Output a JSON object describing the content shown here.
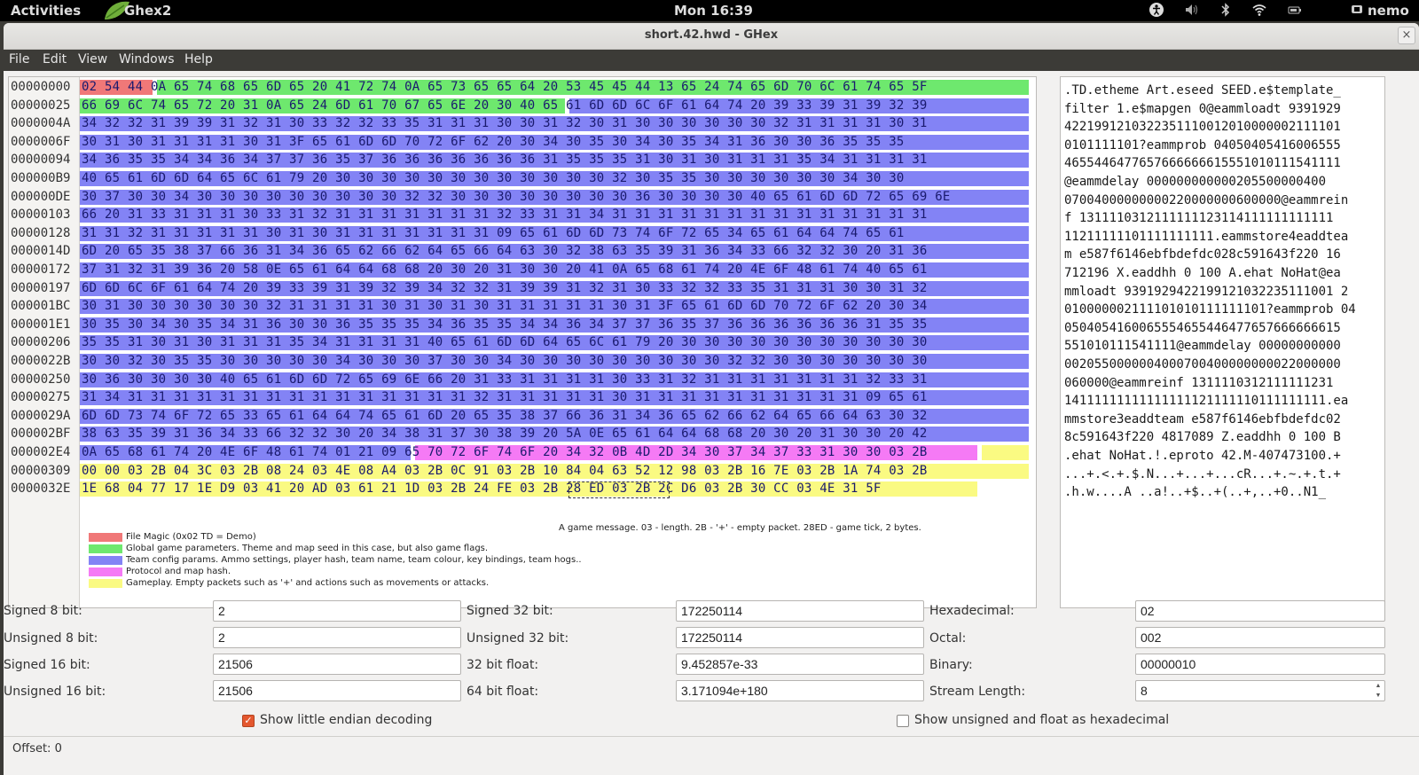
{
  "system_bar": {
    "activities": "Activities",
    "app_name": "Ghex2",
    "clock": "Mon 16:39",
    "user": "nemo",
    "tray_icons": [
      "accessibility-icon",
      "volume-icon",
      "bluetooth-icon",
      "wifi-icon",
      "battery-icon",
      "user-icon"
    ]
  },
  "window": {
    "title": "short.42.hwd - GHex",
    "close_glyph": "×"
  },
  "menu": {
    "items": [
      "File",
      "Edit",
      "View",
      "Windows",
      "Help"
    ]
  },
  "colors": {
    "file_magic": "#f07878",
    "global_params": "#6ee86e",
    "team_config": "#8383f5",
    "protocol_map": "#f57af5",
    "gameplay": "#fafa82"
  },
  "hex": {
    "rows": [
      {
        "offset": "00000000",
        "bytes": "02 54 44 0A 65 74 68 65 6D 65 20 41 72 74 0A 65 73 65 65 64 20 53 45 45 44 13 65 24 74 65 6D 70 6C 61 74 65 5F",
        "ascii": ".TD.etheme Art.eseed SEED.e$template_"
      },
      {
        "offset": "00000025",
        "bytes": "66 69 6C 74 65 72 20 31 0A 65 24 6D 61 70 67 65 6E 20 30 40 65 61 6D 6D 6C 6F 61 64 74 20 39 33 39 31 39 32 39",
        "ascii": "filter 1.e$mapgen 0@eammloadt 9391929"
      },
      {
        "offset": "0000004A",
        "bytes": "34 32 32 31 39 39 31 32 31 30 33 32 32 33 35 31 31 31 30 30 31 32 30 31 30 30 30 30 30 30 32 31 31 31 31 30 31",
        "ascii": "4221991210322351110012010000002111101"
      },
      {
        "offset": "0000006F",
        "bytes": "30 31 30 31 31 31 31 30 31 3F 65 61 6D 6D 70 72 6F 62 20 30 34 30 35 30 34 30 35 34 31 36 30 30 36 35 35 35",
        "ascii": "0101111101?eammprob 04050405416006555"
      },
      {
        "offset": "00000094",
        "bytes": "34 36 35 35 34 34 36 34 37 37 36 35 37 36 36 36 36 36 36 36 31 35 35 35 31 30 31 30 31 31 31 35 34 31 31 31 31",
        "ascii": "4655446477657666666615551010111541111"
      },
      {
        "offset": "000000B9",
        "bytes": "40 65 61 6D 6D 64 65 6C 61 79 20 30 30 30 30 30 30 30 30 30 30 30 30 32 30 35 35 30 30 30 30 30 30 34 30 30",
        "ascii": "@eammdelay 000000000000205500000400"
      },
      {
        "offset": "000000DE",
        "bytes": "30 37 30 30 34 30 30 30 30 30 30 30 30 30 32 32 30 30 30 30 30 30 30 30 36 30 30 30 30 40 65 61 6D 6D 72 65 69 6E",
        "ascii": "07004000000000220000000600000@eammrein"
      },
      {
        "offset": "00000103",
        "bytes": "66 20 31 33 31 31 31 30 33 31 32 31 31 31 31 31 31 31 32 33 31 31 34 31 31 31 31 31 31 31 31 31 31 31 31 31 31",
        "ascii": "f 1311110312111111123114111111111111"
      },
      {
        "offset": "00000128",
        "bytes": "31 31 32 31 31 31 31 31 30 31 30 31 31 31 31 31 31 31 09 65 61 6D 6D 73 74 6F 72 65 34 65 61 64 64 74 65 61",
        "ascii": "11211111101111111111.eammstore4eaddtea"
      },
      {
        "offset": "0000014D",
        "bytes": "6D 20 65 35 38 37 66 36 31 34 36 65 62 66 62 64 65 66 64 63 30 32 38 63 35 39 31 36 34 33 66 32 32 30 20 31 36",
        "ascii": "m e587f6146ebfbdefdc028c591643f220 16"
      },
      {
        "offset": "00000172",
        "bytes": "37 31 32 31 39 36 20 58 0E 65 61 64 64 68 68 20 30 20 31 30 30 20 41 0A 65 68 61 74 20 4E 6F 48 61 74 40 65 61",
        "ascii": "712196 X.eaddhh 0 100 A.ehat NoHat@ea"
      },
      {
        "offset": "00000197",
        "bytes": "6D 6D 6C 6F 61 64 74 20 39 33 39 31 39 32 39 34 32 32 31 39 39 31 32 31 30 33 32 32 33 35 31 31 31 30 30 31 32",
        "ascii": "mmloadt 9391929422199121032235111001 2"
      },
      {
        "offset": "000001BC",
        "bytes": "30 31 30 30 30 30 30 30 32 31 31 31 31 30 31 30 31 30 31 31 31 31 31 30 31 3F 65 61 6D 6D 70 72 6F 62 20 30 34",
        "ascii": "010000002111101010111111101?eammprob 04"
      },
      {
        "offset": "000001E1",
        "bytes": "30 35 30 34 30 35 34 31 36 30 30 36 35 35 35 34 36 35 35 34 34 36 34 37 37 36 35 37 36 36 36 36 36 36 31 35 35",
        "ascii": "0504054160065554655446477657666666615"
      },
      {
        "offset": "00000206",
        "bytes": "35 35 31 30 31 30 31 31 31 35 34 31 31 31 31 40 65 61 6D 6D 64 65 6C 61 79 20 30 30 30 30 30 30 30 30 30 30 30",
        "ascii": "551010111541111@eammdelay 00000000000"
      },
      {
        "offset": "0000022B",
        "bytes": "30 30 32 30 35 35 30 30 30 30 30 34 30 30 30 37 30 30 34 30 30 30 30 30 30 30 30 30 32 32 30 30 30 30 30 30 30",
        "ascii": "0020550000004000700400000000022000000"
      },
      {
        "offset": "00000250",
        "bytes": "30 36 30 30 30 30 40 65 61 6D 6D 72 65 69 6E 66 20 31 33 31 31 31 31 30 33 31 32 31 31 31 31 31 31 31 32 33 31",
        "ascii": "060000@eammreinf 1311110312111111231"
      },
      {
        "offset": "00000275",
        "bytes": "31 34 31 31 31 31 31 31 31 31 31 31 31 31 31 31 31 32 31 31 31 31 31 30 31 31 31 31 31 31 31 31 31 31 09 65 61",
        "ascii": "14111111111111111121111110111111111.ea"
      },
      {
        "offset": "0000029A",
        "bytes": "6D 6D 73 74 6F 72 65 33 65 61 64 64 74 65 61 6D 20 65 35 38 37 66 36 31 34 36 65 62 66 62 64 65 66 64 63 30 32",
        "ascii": "mmstore3eaddteam e587f6146ebfbdefdc02"
      },
      {
        "offset": "000002BF",
        "bytes": "38 63 35 39 31 36 34 33 66 32 32 30 20 34 38 31 37 30 38 39 20 5A 0E 65 61 64 64 68 68 20 30 20 31 30 30 20 42",
        "ascii": "8c591643f220 4817089 Z.eaddhh 0 100 B"
      },
      {
        "offset": "000002E4",
        "bytes": "0A 65 68 61 74 20 4E 6F 48 61 74 01 21 09 65 70 72 6F 74 6F 20 34 32 0B 4D 2D 34 30 37 34 37 33 31 30 30 03 2B",
        "ascii": ".ehat NoHat.!.eproto 42.M-407473100.+"
      },
      {
        "offset": "00000309",
        "bytes": "00 00 03 2B 04 3C 03 2B 08 24 03 4E 08 A4 03 2B 0C 91 03 2B 10 84 04 63 52 12 98 03 2B 16 7E 03 2B 1A 74 03 2B",
        "ascii": "...+.<.+.$.N...+...+...cR...+.~.+.t.+"
      },
      {
        "offset": "0000032E",
        "bytes": "1E 68 04 77 17 1E D9 03 41 20 AD 03 61 21 1D 03 2B 24 FE 03 2B 28 ED 03 2B 2C D6 03 2B 30 CC 03 4E 31 5F",
        "ascii": ".h.w....A ..a!..+$..+(..+,..+0..N1_"
      }
    ],
    "annotation": "A game message. 03 - length. 2B - '+' - empty packet. 28ED - game tick, 2 bytes."
  },
  "legend": [
    {
      "key": "file_magic",
      "label": "File Magic (0x02 TD = Demo)"
    },
    {
      "key": "global_params",
      "label": "Global game parameters. Theme and map seed in this case, but also game flags."
    },
    {
      "key": "team_config",
      "label": "Team config params. Ammo settings, player hash, team name, team colour, key bindings, team hogs.."
    },
    {
      "key": "protocol_map",
      "label": "Protocol and map hash."
    },
    {
      "key": "gameplay",
      "label": "Gameplay.  Empty packets such as '+' and actions such as movements or attacks."
    }
  ],
  "decoder": {
    "signed8_label": "Signed 8 bit:",
    "signed8": "2",
    "unsigned8_label": "Unsigned 8 bit:",
    "unsigned8": "2",
    "signed16_label": "Signed 16 bit:",
    "signed16": "21506",
    "unsigned16_label": "Unsigned 16 bit:",
    "unsigned16": "21506",
    "signed32_label": "Signed 32 bit:",
    "signed32": "172250114",
    "unsigned32_label": "Unsigned 32 bit:",
    "unsigned32": "172250114",
    "float32_label": "32 bit float:",
    "float32": "9.452857e-33",
    "float64_label": "64 bit float:",
    "float64": "3.171094e+180",
    "hex_label": "Hexadecimal:",
    "hex": "02",
    "octal_label": "Octal:",
    "octal": "002",
    "binary_label": "Binary:",
    "binary": "00000010",
    "stream_label": "Stream Length:",
    "stream": "8",
    "little_endian_label": "Show little endian decoding",
    "little_endian_checked": true,
    "unsigned_hex_label": "Show unsigned and float as hexadecimal",
    "unsigned_hex_checked": false
  },
  "status": {
    "offset_text": "Offset: 0"
  }
}
